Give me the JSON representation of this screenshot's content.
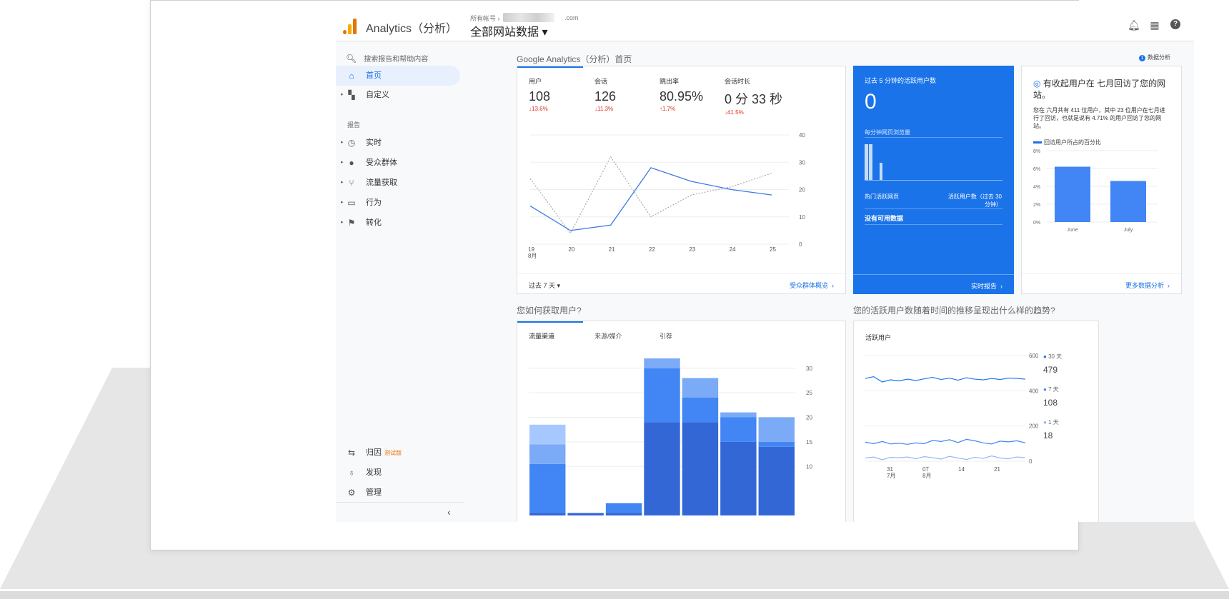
{
  "header": {
    "app_title": "Analytics（分析）",
    "account_label": "所有帐号 ›",
    "account_domain": ".com",
    "property": "全部网站数据 ▾"
  },
  "sidebar": {
    "search_placeholder": "搜索报告和帮助内容",
    "home": "首页",
    "customize": "自定义",
    "reports_label": "报告",
    "reports": [
      "实时",
      "受众群体",
      "流量获取",
      "行为",
      "转化"
    ],
    "attribution": "归因",
    "beta": "测试版",
    "discover": "发现",
    "admin": "管理"
  },
  "page": {
    "breadcrumb": "Google Analytics（分析）首页",
    "insights": "数据分析",
    "insights_count": "1"
  },
  "kpis": [
    {
      "label": "用户",
      "value": "108",
      "delta": "↓13.6%"
    },
    {
      "label": "会话",
      "value": "126",
      "delta": "↓11.3%"
    },
    {
      "label": "跳出率",
      "value": "80.95%",
      "delta": "↑1.7%"
    },
    {
      "label": "会话时长",
      "value": "0 分 33 秒",
      "delta": "↓41.5%"
    }
  ],
  "users_chart": {
    "x_labels": [
      "19\n8月",
      "20",
      "21",
      "22",
      "23",
      "24",
      "25"
    ],
    "y_ticks": [
      "40",
      "30",
      "20",
      "10",
      "0"
    ],
    "current": [
      14,
      5,
      7,
      28,
      23,
      20,
      18
    ],
    "previous": [
      24,
      4,
      32,
      10,
      18,
      21,
      26
    ],
    "date_range": "过去 7 天 ▾",
    "link": "受众群体概览"
  },
  "realtime": {
    "title": "过去 5 分钟的活跃用户数",
    "value": "0",
    "pageviews_label": "每分钟网页浏览量",
    "top_pages": "热门活跃网页",
    "active_users_col": "活跃用户数（过去 30 分钟）",
    "no_data": "没有可用数据",
    "link": "实时报告"
  },
  "retention": {
    "title": "有收起用户在 七月回访了您的网站。",
    "body": "您在 六月共有 411 位用户，其中 23 位用户在七月进行了回访，也就是说有 4.71% 的用户回访了您的网站。",
    "legend": "回访用户所占的百分比",
    "categories": [
      "June",
      "July"
    ],
    "values": [
      6.2,
      4.6
    ],
    "y_ticks": [
      "8%",
      "6%",
      "4%",
      "2%",
      "0%"
    ],
    "link": "更多数据分析"
  },
  "acquisition": {
    "question": "您如何获取用户?",
    "tabs": [
      "流量渠道",
      "来源/媒介",
      "引荐"
    ],
    "y_ticks": [
      "30",
      "25",
      "20",
      "15",
      "10"
    ],
    "stacks": [
      [
        0.5,
        10,
        4,
        4
      ],
      [
        0.5,
        0,
        0,
        0
      ],
      [
        0.5,
        2,
        0,
        0
      ],
      [
        19,
        11,
        2,
        0
      ],
      [
        19,
        5,
        4,
        0
      ],
      [
        15,
        5,
        1,
        0
      ],
      [
        14,
        1,
        5,
        0
      ]
    ]
  },
  "active_users": {
    "question": "您的活跃用户数随着时间的推移呈现出什么样的趋势?",
    "title": "活跃用户",
    "y_ticks": [
      "600",
      "400",
      "200",
      "0"
    ],
    "x_labels": [
      "31\n7月",
      "07\n8月",
      "14",
      "21"
    ],
    "series": [
      {
        "name": "30 天",
        "value": "479",
        "color": "#1a73e8"
      },
      {
        "name": "7 天",
        "value": "108",
        "color": "#4285f4"
      },
      {
        "name": "1 天",
        "value": "18",
        "color": "#8ab4f8"
      }
    ]
  }
}
